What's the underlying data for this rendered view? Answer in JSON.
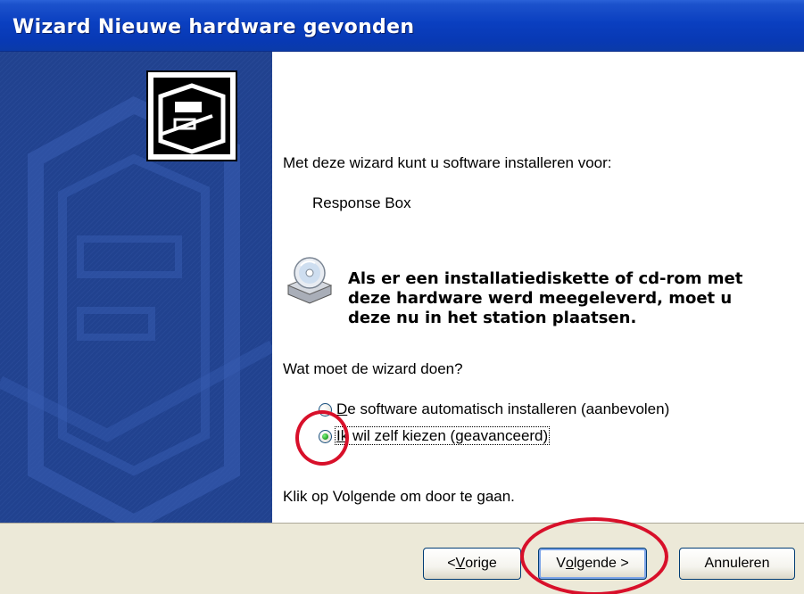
{
  "window": {
    "title": "Wizard Nieuwe hardware gevonden"
  },
  "content": {
    "intro": "Met deze wizard kunt u software installeren voor:",
    "device_name": "Response Box",
    "disk_notice": [
      "Als er een installatiediskette of cd-rom met",
      "deze hardware werd meegeleverd, moet u",
      "deze nu in het station plaatsen."
    ],
    "question": "Wat moet de wizard doen?",
    "options": [
      {
        "pre": "",
        "ul": "D",
        "post": "e software automatisch installeren (aanbevolen)",
        "selected": false
      },
      {
        "pre": "",
        "ul": "Ik",
        "post": " wil zelf kiezen (geavanceerd)",
        "selected": true
      }
    ],
    "instruction": "Klik op Volgende om door te gaan."
  },
  "buttons": {
    "back": {
      "pre": "< ",
      "ul": "V",
      "post": "orige"
    },
    "next": {
      "pre": "V",
      "ul": "o",
      "post": "lgende >"
    },
    "cancel": "Annuleren"
  },
  "icons": {
    "wizard": "hardware-card-icon",
    "disk": "cd-drive-icon"
  },
  "colors": {
    "titlebar": "#0a3fc0",
    "banner": "#1e3f8c",
    "annotation": "#d8102a",
    "radio_selected": "#21a121"
  }
}
